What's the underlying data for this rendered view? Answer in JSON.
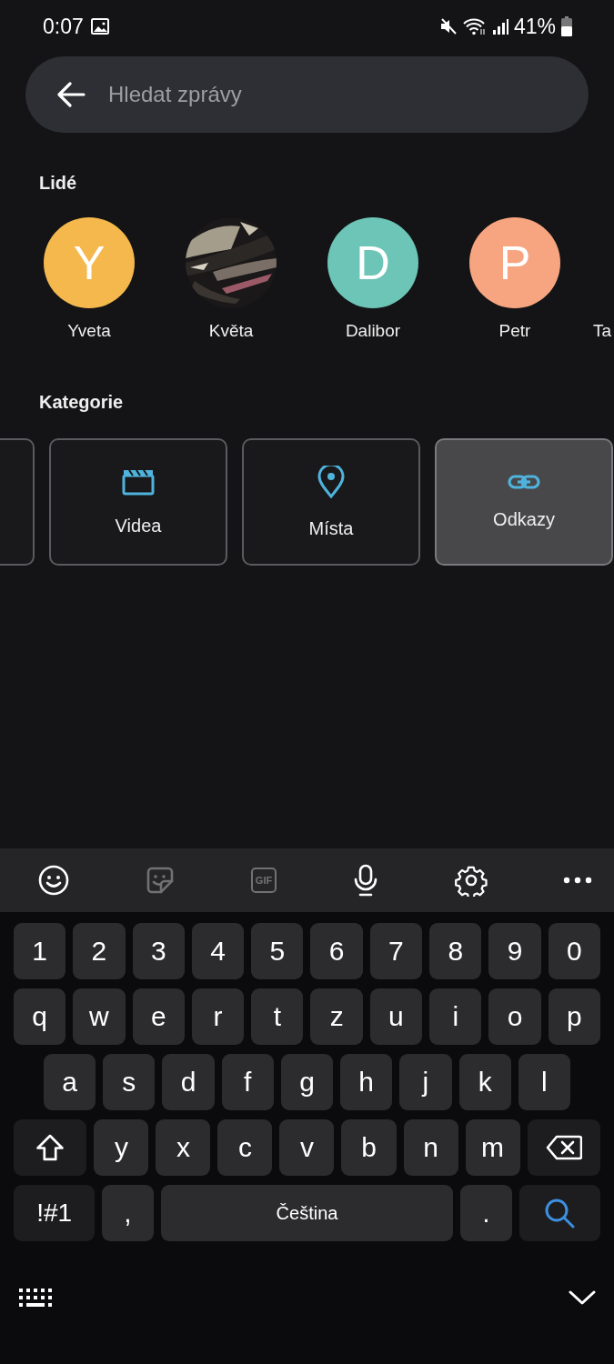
{
  "status_bar": {
    "time": "0:07",
    "battery": "41%"
  },
  "search": {
    "placeholder": "Hledat zprávy"
  },
  "people": {
    "title": "Lidé",
    "items": [
      {
        "name": "Yveta",
        "kind": "letter",
        "initial": "Y",
        "color": "#f5b84c"
      },
      {
        "name": "Květa",
        "kind": "picture"
      },
      {
        "name": "Dalibor",
        "kind": "letter",
        "initial": "D",
        "color": "#6cc5b6"
      },
      {
        "name": "Petr",
        "kind": "letter",
        "initial": "P",
        "color": "#f7a580"
      },
      {
        "name": "Ta"
      }
    ]
  },
  "categories": {
    "title": "Kategorie",
    "items": [
      {
        "selected": false
      },
      {
        "kind": "video",
        "label": "Videa",
        "selected": false
      },
      {
        "kind": "place",
        "label": "Místa",
        "selected": false
      },
      {
        "kind": "link",
        "label": "Odkazy",
        "selected": true
      }
    ]
  },
  "keyboard_toolbar": [
    {
      "kind": "emoji",
      "disabled": false
    },
    {
      "kind": "sticker",
      "disabled": true
    },
    {
      "kind": "gif",
      "label": "GIF",
      "disabled": true
    },
    {
      "kind": "mic",
      "disabled": false
    },
    {
      "kind": "settings",
      "disabled": false
    },
    {
      "kind": "more",
      "disabled": false
    }
  ],
  "keyboard": {
    "number_row": [
      {
        "kind": "char",
        "label": "1"
      },
      {
        "kind": "char",
        "label": "2"
      },
      {
        "kind": "char",
        "label": "3"
      },
      {
        "kind": "char",
        "label": "4"
      },
      {
        "kind": "char",
        "label": "5"
      },
      {
        "kind": "char",
        "label": "6"
      },
      {
        "kind": "char",
        "label": "7"
      },
      {
        "kind": "char",
        "label": "8"
      },
      {
        "kind": "char",
        "label": "9"
      },
      {
        "kind": "char",
        "label": "0"
      }
    ],
    "top_row": [
      {
        "kind": "char",
        "label": "q"
      },
      {
        "kind": "char",
        "label": "w"
      },
      {
        "kind": "char",
        "label": "e"
      },
      {
        "kind": "char",
        "label": "r"
      },
      {
        "kind": "char",
        "label": "t"
      },
      {
        "kind": "char",
        "label": "z"
      },
      {
        "kind": "char",
        "label": "u"
      },
      {
        "kind": "char",
        "label": "i"
      },
      {
        "kind": "char",
        "label": "o"
      },
      {
        "kind": "char",
        "label": "p"
      }
    ],
    "home_row": [
      {
        "kind": "char",
        "label": "a"
      },
      {
        "kind": "char",
        "label": "s"
      },
      {
        "kind": "char",
        "label": "d"
      },
      {
        "kind": "char",
        "label": "f"
      },
      {
        "kind": "char",
        "label": "g"
      },
      {
        "kind": "char",
        "label": "h"
      },
      {
        "kind": "char",
        "label": "j"
      },
      {
        "kind": "char",
        "label": "k"
      },
      {
        "kind": "char",
        "label": "l"
      }
    ],
    "bottom_row": [
      {
        "kind": "shift"
      },
      {
        "kind": "char",
        "label": "y"
      },
      {
        "kind": "char",
        "label": "x"
      },
      {
        "kind": "char",
        "label": "c"
      },
      {
        "kind": "char",
        "label": "v"
      },
      {
        "kind": "char",
        "label": "b"
      },
      {
        "kind": "char",
        "label": "n"
      },
      {
        "kind": "char",
        "label": "m"
      },
      {
        "kind": "backspace"
      }
    ],
    "function_row": [
      {
        "kind": "symbols",
        "label": "!#1"
      },
      {
        "kind": "punct",
        "label": ","
      },
      {
        "kind": "space",
        "label": "Čeština"
      },
      {
        "kind": "punct",
        "label": "."
      },
      {
        "kind": "search"
      }
    ]
  }
}
